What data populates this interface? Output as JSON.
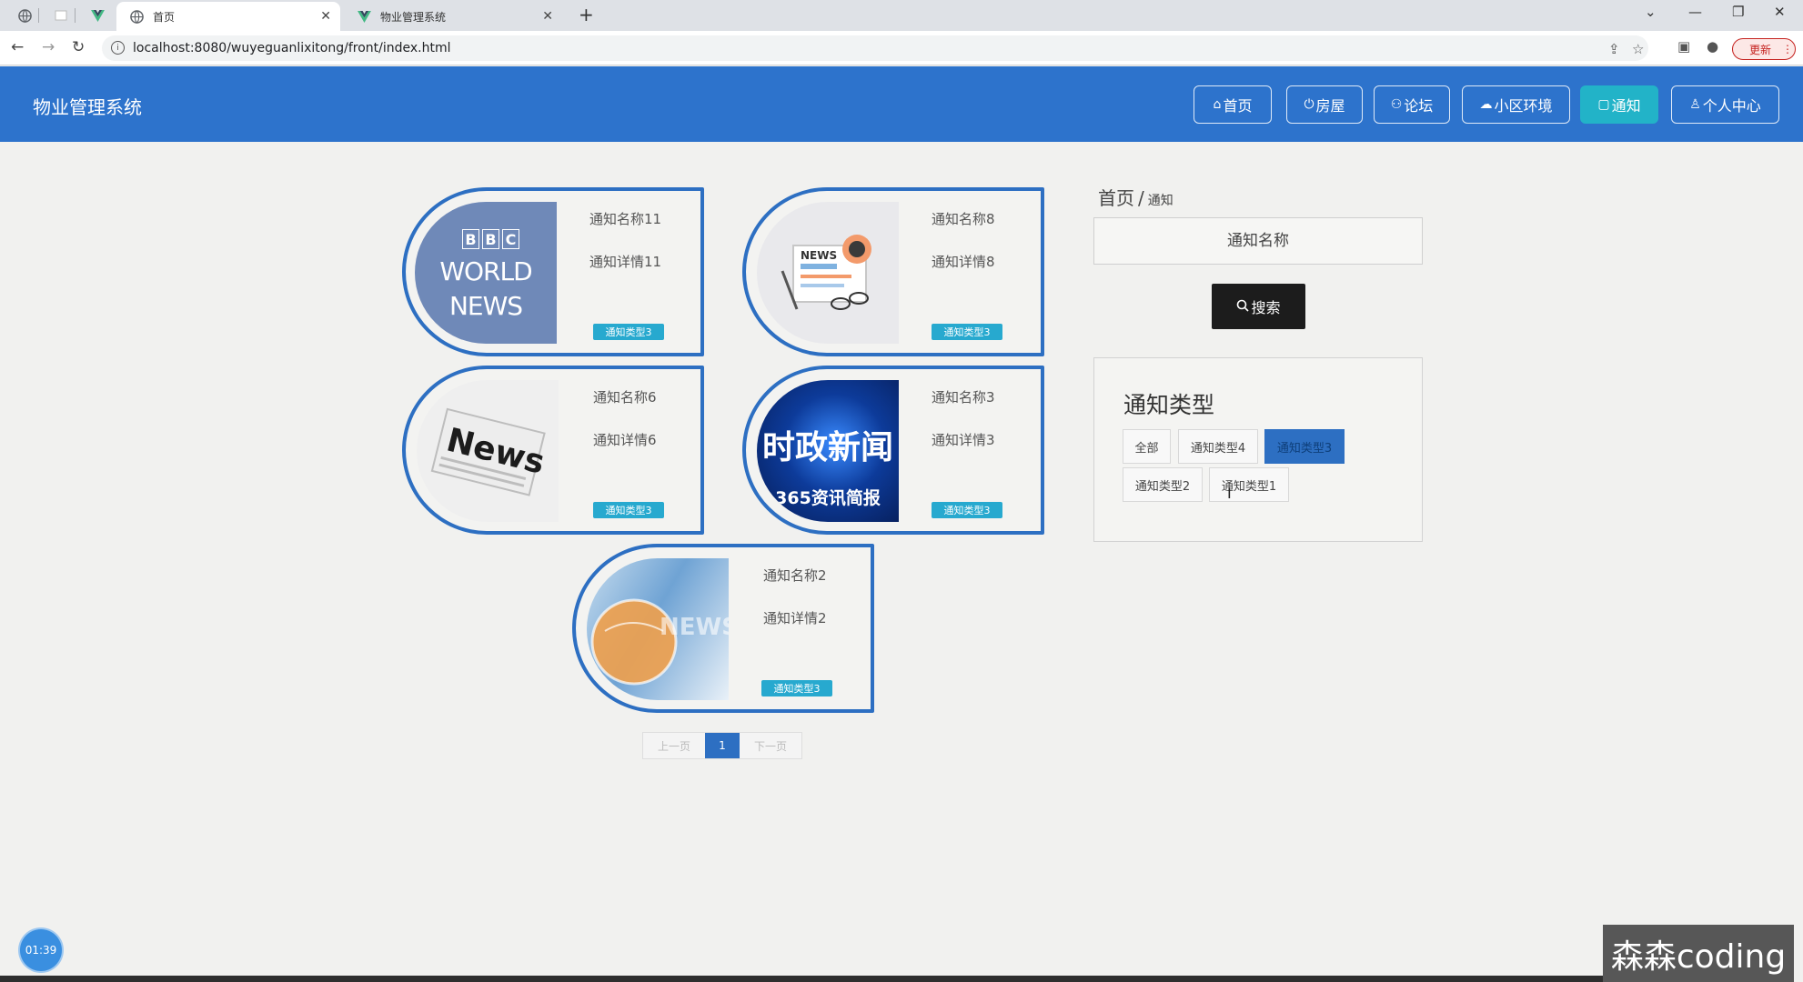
{
  "browser": {
    "tabs": [
      {
        "title": "首页",
        "icon": "globe-icon"
      },
      {
        "title": "物业管理系统",
        "icon": "vue-logo-icon"
      }
    ],
    "url": "localhost:8080/wuyeguanlixitong/front/index.html",
    "update_label": "更新"
  },
  "site": {
    "title": "物业管理系统",
    "nav": [
      {
        "label": "首页",
        "icon": "home-icon"
      },
      {
        "label": "房屋",
        "icon": "power-icon"
      },
      {
        "label": "论坛",
        "icon": "forum-icon"
      },
      {
        "label": "小区环境",
        "icon": "cloud-icon"
      },
      {
        "label": "通知",
        "icon": "notice-icon"
      },
      {
        "label": "个人中心",
        "icon": "user-icon"
      }
    ],
    "active_nav": "通知"
  },
  "notices": [
    {
      "name": "通知名称11",
      "detail": "通知详情11",
      "type": "通知类型3",
      "image": "bbc-world-news"
    },
    {
      "name": "通知名称8",
      "detail": "通知详情8",
      "type": "通知类型3",
      "image": "newspaper-illustration"
    },
    {
      "name": "通知名称6",
      "detail": "通知详情6",
      "type": "通知类型3",
      "image": "news-paper"
    },
    {
      "name": "通知名称3",
      "detail": "通知详情3",
      "type": "通知类型3",
      "image": "shizheng-news"
    },
    {
      "name": "通知名称2",
      "detail": "通知详情2",
      "type": "通知类型3",
      "image": "globe-news"
    }
  ],
  "image_text": {
    "bbc_letters": [
      "B",
      "B",
      "C"
    ],
    "bbc_line1": "WORLD",
    "bbc_line2": "NEWS",
    "news1_label": "NEWS",
    "news2_label": "News",
    "shizheng_title": "时政新闻",
    "shizheng_sub": "365资讯简报",
    "globe_label": "NEWS"
  },
  "pagination": {
    "prev": "上一页",
    "current": "1",
    "next": "下一页"
  },
  "sidebar": {
    "breadcrumb_home": "首页",
    "breadcrumb_sep": "/",
    "breadcrumb_current": "通知",
    "search_placeholder": "通知名称",
    "search_button": "搜索",
    "type_title": "通知类型",
    "types": [
      "全部",
      "通知类型4",
      "通知类型3",
      "通知类型2",
      "通知类型1"
    ],
    "active_type": "通知类型3"
  },
  "overlay": {
    "timer": "01:39",
    "watermark": "森森coding"
  },
  "colors": {
    "header": "#2d73cc",
    "accent": "#2d6fc2",
    "active_nav": "#22b3c8",
    "badge": "#27a9cf"
  }
}
